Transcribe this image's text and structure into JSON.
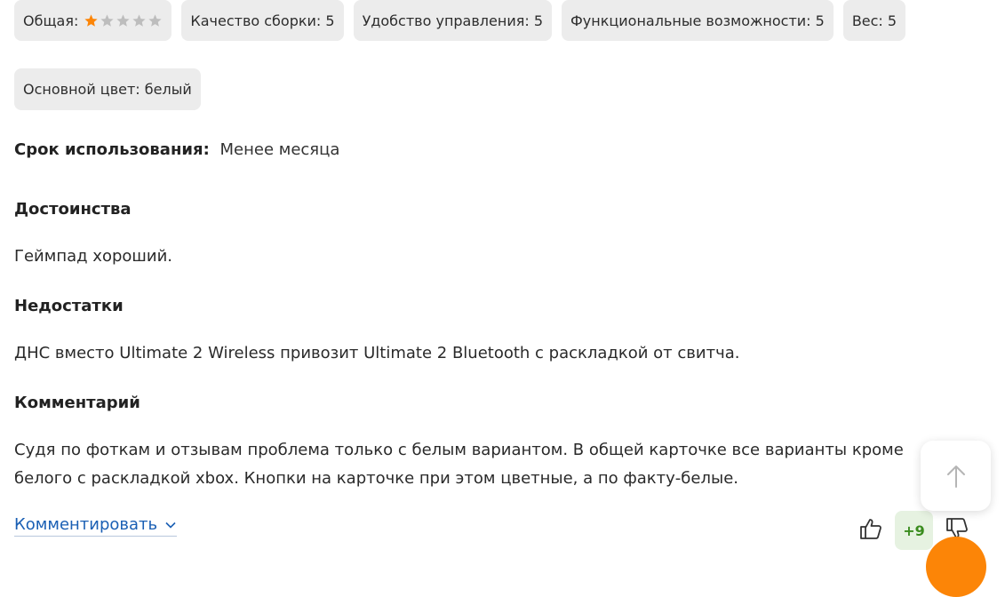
{
  "ratings": {
    "overall_label": "Общая:",
    "overall_value": 1,
    "overall_max": 5,
    "star_active_color": "#fc8507",
    "star_inactive_color": "#bdbdbd",
    "build_quality": "Качество сборки: 5",
    "ease_of_control": "Удобство управления: 5",
    "functionality": "Функциональные возможности: 5",
    "weight": "Вес: 5",
    "main_color": "Основной цвет: белый"
  },
  "usage": {
    "label": "Срок использования:",
    "value": "Менее месяца"
  },
  "advantages": {
    "title": "Достоинства",
    "text": "Геймпад хороший."
  },
  "disadvantages": {
    "title": "Недостатки",
    "text": "ДНС вместо Ultimate 2 Wireless привозит Ultimate 2 Bluetooth с раскладкой от свитча."
  },
  "comment": {
    "title": "Комментарий",
    "text": "Судя по фоткам и отзывам проблема только с белым вариантом. В общей  карточке все варианты кроме белого с раскладкой xbox. Кнопки на карточке при этом цветные, а по факту-белые."
  },
  "actions": {
    "comment_link": "Комментировать",
    "score": "+9",
    "up_icon": "thumbs-up-icon",
    "down_icon": "thumbs-down-icon",
    "scroll_icon": "arrow-up-icon"
  }
}
